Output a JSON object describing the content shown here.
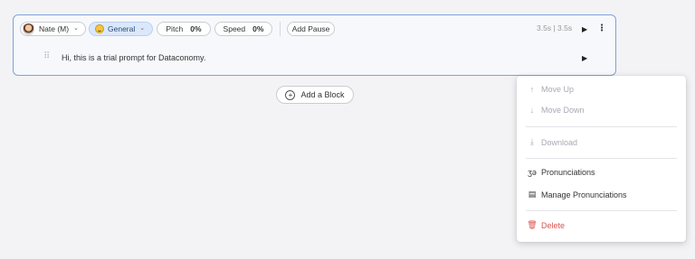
{
  "block": {
    "voice": "Nate (M)",
    "style": "General",
    "pitch_label": "Pitch",
    "pitch_value": "0%",
    "speed_label": "Speed",
    "speed_value": "0%",
    "add_pause": "Add Pause",
    "duration": "3.5s | 3.5s",
    "prompt_text": "Hi, this is a trial prompt for Dataconomy."
  },
  "add_block": "Add a Block",
  "menu": {
    "move_up": "Move Up",
    "move_down": "Move Down",
    "download": "Download",
    "pronunciations": "Pronunciations",
    "manage_pronunciations": "Manage Pronunciations",
    "delete": "Delete"
  },
  "colors": {
    "accent": "#7ea3d6",
    "delete": "#d9534f",
    "style_pill": "#dbe8fb"
  }
}
